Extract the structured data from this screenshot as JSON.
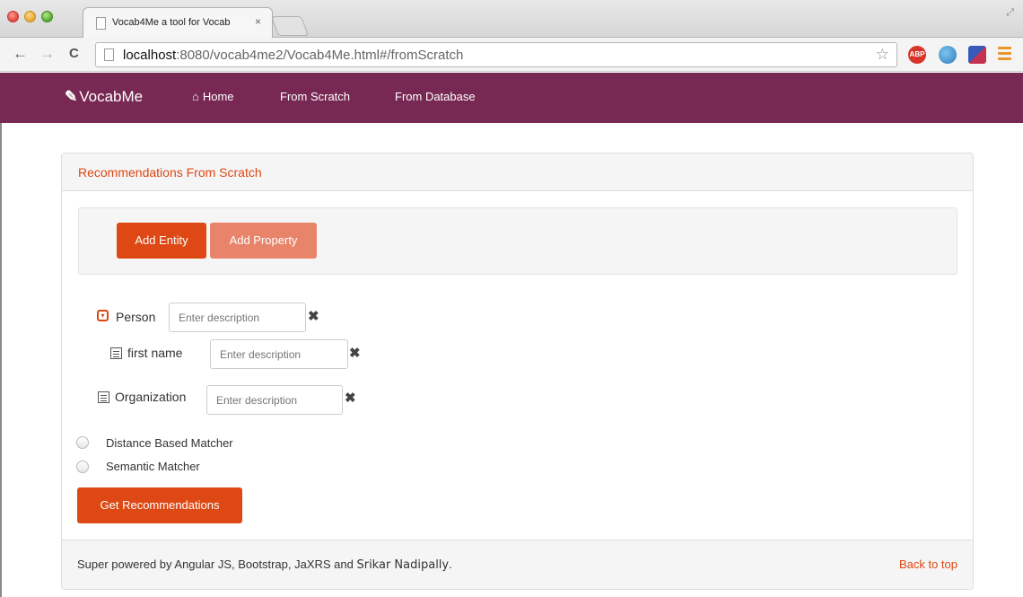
{
  "browser": {
    "tab_title": "Vocab4Me a tool for Vocab",
    "tab_close": "×",
    "url_host": "localhost",
    "url_rest": ":8080/vocab4me2/Vocab4Me.html#/fromScratch",
    "ext_abp": "ABP"
  },
  "navbar": {
    "brand": "VocabMe",
    "links": [
      {
        "label": "Home",
        "icon": "home-icon"
      },
      {
        "label": "From Scratch"
      },
      {
        "label": "From Database"
      }
    ]
  },
  "panel": {
    "title": "Recommendations From Scratch",
    "buttons": {
      "add_entity": "Add Entity",
      "add_property": "Add Property"
    },
    "tree": [
      {
        "label": "Person",
        "type": "entity",
        "expanded": true,
        "placeholder": "Enter description",
        "icon": "collapse-toggle-icon"
      },
      {
        "label": "first name",
        "type": "property",
        "placeholder": "Enter description",
        "icon": "list-icon"
      },
      {
        "label": "Organization",
        "type": "entity",
        "placeholder": "Enter description",
        "icon": "list-icon"
      }
    ],
    "matchers": [
      {
        "label": "Distance Based Matcher",
        "selected": false
      },
      {
        "label": "Semantic Matcher",
        "selected": false
      }
    ],
    "get_recommendations": "Get Recommendations"
  },
  "footer": {
    "text": "Super powered by Angular JS, Bootstrap, JaXRS and ",
    "author": "Srikar Nadipally",
    "period": ".",
    "back_to_top": "Back to top"
  },
  "colors": {
    "navbar": "#772953",
    "accent": "#dd4814",
    "accent_light": "#e8846a"
  }
}
